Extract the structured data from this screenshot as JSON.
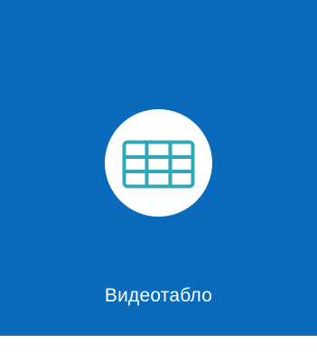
{
  "tile": {
    "label": "Видеотабло",
    "icon": "video-wall-grid-icon",
    "background_color": "#0a6abb",
    "icon_circle_color": "#ffffff",
    "icon_color": "#2fa9b5"
  }
}
